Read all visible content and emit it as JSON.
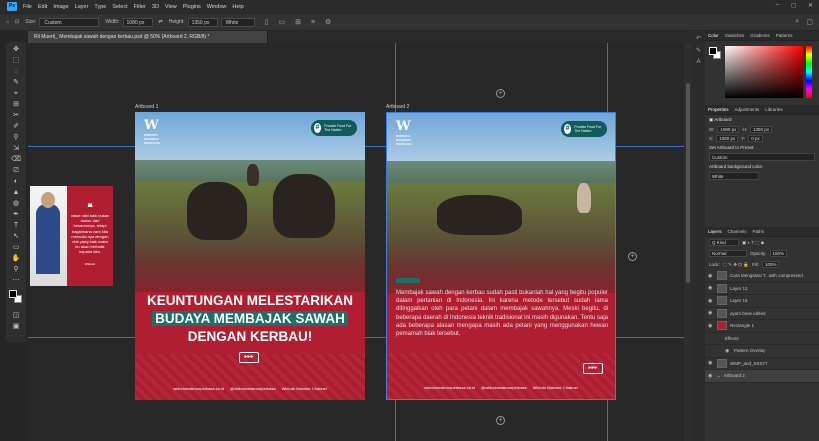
{
  "menu": {
    "app_logo": "Ps",
    "items": [
      "File",
      "Edit",
      "Image",
      "Layer",
      "Type",
      "Select",
      "Filter",
      "3D",
      "View",
      "Plugins",
      "Window",
      "Help"
    ],
    "window_controls": [
      "–",
      "◻",
      "✕"
    ]
  },
  "options": {
    "size_label": "Size:",
    "size_value": "Custom",
    "width_label": "Width:",
    "width_value": "1080 px",
    "height_label": "Height:",
    "height_value": "1350 px",
    "bg_value": "White"
  },
  "document": {
    "tab_title": "Ril Muerti_ Membajak sawah dengan kerbau.psd @ 50% (Artboard 2, RGB/8) *"
  },
  "tools": [
    "✥",
    "⬚",
    "◌",
    "✎",
    "⌖",
    "⊞",
    "✂",
    "✐",
    "⚲",
    "⇲",
    "⌫",
    "⎚",
    "◐",
    "▲",
    "◍",
    "✒",
    "T",
    "↖",
    "▭",
    "✋",
    "⚲",
    "⋯"
  ],
  "canvas": {
    "artboard1_label": "Artboard 1",
    "artboard2_label": "Artboard 2",
    "plus": "+"
  },
  "artboard1": {
    "logo_letter": "W",
    "logo_sub": "WIDODO MAKMUR PERKASA",
    "badge_hash": "#",
    "badge_text": "Provide Food For The Nation",
    "headline_1": "KEUNTUNGAN MELESTARIKAN",
    "headline_2": "BUDAYA MEMBAJAK SAWAH",
    "headline_3": "DENGAN KERBAU!",
    "play": "▸▸▸",
    "footer_site": "widodomakmurperkasa.co.id",
    "footer_ig": "@widodomakmurperkasa",
    "footer_yt": "Widodo Makmur Channel"
  },
  "artboard2": {
    "logo_letter": "W",
    "logo_sub": "WIDODO MAKMUR PERKASA",
    "badge_hash": "#",
    "badge_text": "Provide Food For The Nation",
    "body": "Membajak sawah dengan kerbau sudah pasti bukanlah hal yang begitu populer dalam pertanian di Indonesia. Ini karena metode tersebut sudah lama ditinggalkan oleh para petani dalam membajak sawahnya. Meski begitu, di beberapa daerah di Indonesia teknik tradisional ini masih digunakan. Tentu saja ada beberapa alasan mengapa masih ada petani yang menggunakan hewan pemamah biak tersebut.",
    "play": "▸▸▸",
    "footer_site": "widodomakmurperkasa.co.id",
    "footer_ig": "@widodomakmurperkasa",
    "footer_yt": "Widodo Makmur Channel"
  },
  "quote_card": {
    "quote_mark": "❝",
    "text": "value nilai baik bukan diukur dari besarannya, tetapi bagaimana cara kita memulai nya dengan niat yang baik maka itu akan berbalik kepada kita.",
    "signature": "Widodo"
  },
  "panels": {
    "color_tabs": [
      "Color",
      "Swatches",
      "Gradients",
      "Patterns"
    ],
    "props_tabs": [
      "Properties",
      "Adjustments",
      "Libraries"
    ],
    "props_type": "Artboard",
    "w_label": "W:",
    "w_value": "1080 px",
    "h_label": "H:",
    "h_value": "1350 px",
    "x_label": "X:",
    "x_value": "1080 px",
    "y_label": "Y:",
    "y_value": "0 px",
    "preset_label": "Set Artboard to Preset:",
    "preset_value": "Custom",
    "bg_color_label": "Artboard background color:",
    "bg_color_value": "White",
    "layers_tabs": [
      "Layers",
      "Channels",
      "Paths"
    ],
    "kind": "Q Kind",
    "blend": "Normal",
    "opacity_label": "Opacity:",
    "opacity_value": "100%",
    "lock_label": "Lock:",
    "fill_label": "Fill:",
    "fill_value": "100%",
    "layers": [
      {
        "name": "Cara Mengatasi T...with compressed"
      },
      {
        "name": "Layer 13"
      },
      {
        "name": "Layer 15"
      },
      {
        "name": "ayam bese edited"
      },
      {
        "name": "Rectangle 1"
      },
      {
        "name": "Effects"
      },
      {
        "name": "Pattern Overlay"
      },
      {
        "name": "WMP_and_SSS77"
      },
      {
        "name": "Artboard 2"
      }
    ]
  }
}
